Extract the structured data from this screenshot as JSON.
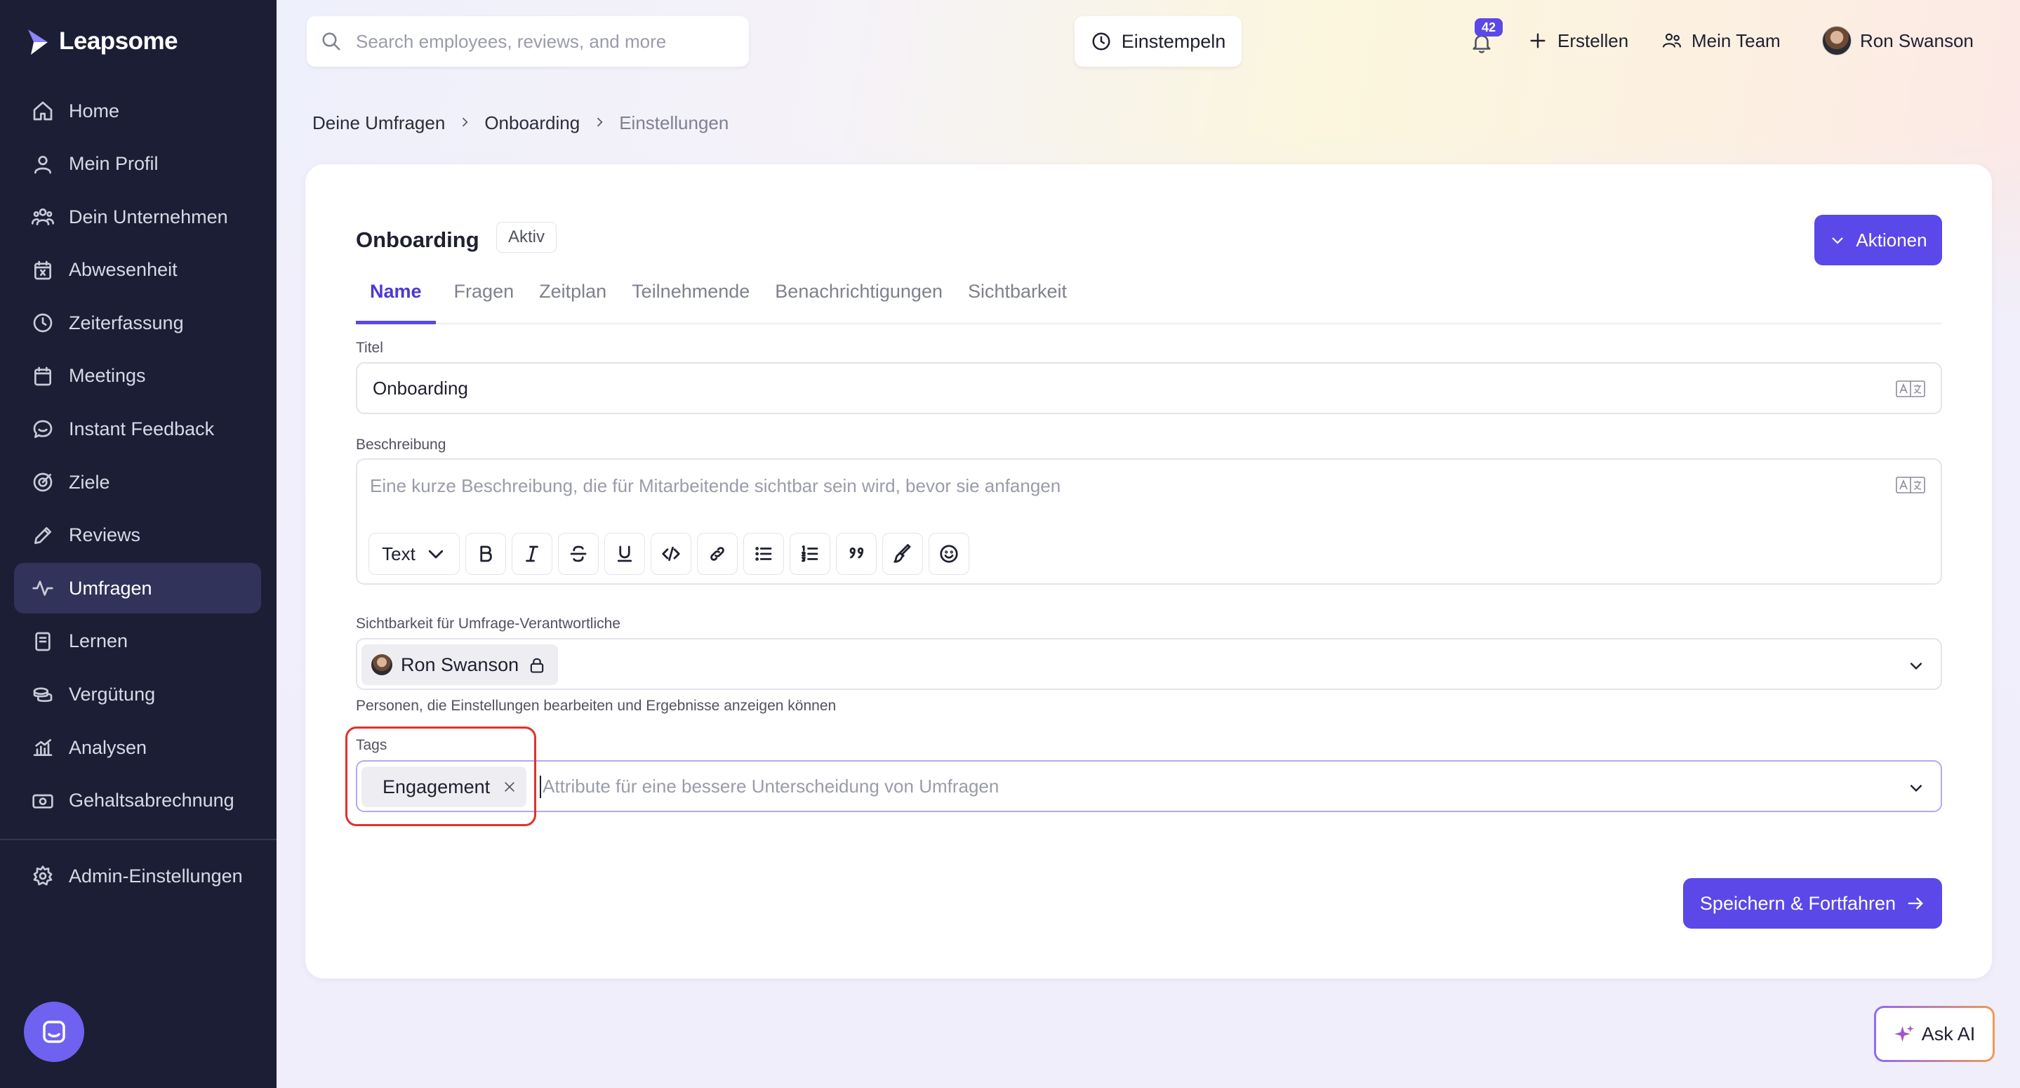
{
  "app": {
    "name": "Leapsome"
  },
  "sidebar": {
    "items": [
      {
        "label": "Home",
        "icon": "home-icon"
      },
      {
        "label": "Mein Profil",
        "icon": "user-icon"
      },
      {
        "label": "Dein Unternehmen",
        "icon": "people-icon"
      },
      {
        "label": "Abwesenheit",
        "icon": "calendar-x-icon"
      },
      {
        "label": "Zeiterfassung",
        "icon": "clock-icon"
      },
      {
        "label": "Meetings",
        "icon": "calendar-icon"
      },
      {
        "label": "Instant Feedback",
        "icon": "chat-icon"
      },
      {
        "label": "Ziele",
        "icon": "target-icon"
      },
      {
        "label": "Reviews",
        "icon": "pencil-icon"
      },
      {
        "label": "Umfragen",
        "icon": "pulse-icon",
        "active": true
      },
      {
        "label": "Lernen",
        "icon": "book-icon"
      },
      {
        "label": "Vergütung",
        "icon": "coins-icon"
      },
      {
        "label": "Analysen",
        "icon": "chart-icon"
      },
      {
        "label": "Gehaltsabrechnung",
        "icon": "money-icon"
      }
    ],
    "admin": {
      "label": "Admin-Einstellungen",
      "icon": "gear-icon"
    }
  },
  "topbar": {
    "search_placeholder": "Search employees, reviews, and more",
    "clock_in": "Einstempeln",
    "notifications_count": "42",
    "create": "Erstellen",
    "my_team": "Mein Team",
    "user_name": "Ron Swanson"
  },
  "breadcrumb": [
    "Deine Umfragen",
    "Onboarding",
    "Einstellungen"
  ],
  "survey": {
    "title": "Onboarding",
    "status": "Aktiv",
    "actions_label": "Aktionen",
    "tabs": [
      "Name",
      "Fragen",
      "Zeitplan",
      "Teilnehmende",
      "Benachrichtigungen",
      "Sichtbarkeit"
    ],
    "active_tab": "Name"
  },
  "form": {
    "title_label": "Titel",
    "title_value": "Onboarding",
    "description_label": "Beschreibung",
    "description_placeholder": "Eine kurze Beschreibung, die für Mitarbeitende sichtbar sein wird, bevor sie anfangen",
    "text_style": "Text",
    "visibility_label": "Sichtbarkeit für Umfrage-Verantwortliche",
    "visibility_owner": "Ron Swanson",
    "visibility_helper": "Personen, die Einstellungen bearbeiten und Ergebnisse anzeigen können",
    "tags_label": "Tags",
    "tags": [
      "Engagement"
    ],
    "tags_placeholder": "Attribute für eine bessere Unterscheidung von Umfragen",
    "save_label": "Speichern & Fortfahren"
  },
  "ask_ai": "Ask AI",
  "colors": {
    "accent": "#5b48e8",
    "sidebar_bg": "#1c1e35",
    "highlight": "#e0322a"
  }
}
